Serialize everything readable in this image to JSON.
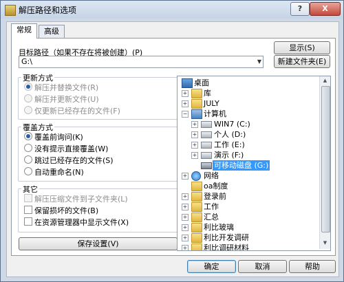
{
  "window": {
    "title": "解压路径和选项",
    "help_glyph": "?",
    "close_glyph": "X"
  },
  "tabs": [
    {
      "label": "常规",
      "active": true
    },
    {
      "label": "高级",
      "active": false
    }
  ],
  "target": {
    "label": "目标路径（如果不存在将被创建）(P)",
    "value": "G:\\",
    "show_button": "显示(S)",
    "new_folder_button": "新建文件夹(E)"
  },
  "update_mode": {
    "title": "更新方式",
    "options": [
      {
        "label": "解压并替换文件(R)",
        "checked": true,
        "enabled": false
      },
      {
        "label": "解压并更新文件(U)",
        "checked": false,
        "enabled": false
      },
      {
        "label": "仅更新已经存在的文件(F)",
        "checked": false,
        "enabled": false
      }
    ]
  },
  "overwrite_mode": {
    "title": "覆盖方式",
    "options": [
      {
        "label": "覆盖前询问(K)",
        "checked": true
      },
      {
        "label": "没有提示直接覆盖(W)",
        "checked": false
      },
      {
        "label": "跳过已经存在的文件(S)",
        "checked": false
      },
      {
        "label": "自动重命名(N)",
        "checked": false
      }
    ]
  },
  "misc": {
    "title": "其它",
    "options": [
      {
        "label": "解压压缩文件到子文件夹(L)",
        "checked": false,
        "enabled": false
      },
      {
        "label": "保留损坏的文件(B)",
        "checked": false,
        "enabled": true
      },
      {
        "label": "在资源管理器中显示文件(X)",
        "checked": false,
        "enabled": true
      }
    ]
  },
  "save_settings_button": "保存设置(V)",
  "tree": {
    "nodes": [
      {
        "label": "桌面",
        "icon": "desktop-icon",
        "expander": ""
      },
      {
        "label": "库",
        "icon": "folder-icon",
        "expander": "+"
      },
      {
        "label": "JULY",
        "icon": "folder-icon",
        "expander": "+"
      },
      {
        "label": "计算机",
        "icon": "computer-icon",
        "expander": "−"
      },
      {
        "label": "WIN7 (C:)",
        "icon": "drive-icon",
        "expander": "+"
      },
      {
        "label": "个人 (D:)",
        "icon": "drive-icon",
        "expander": "+"
      },
      {
        "label": "工作 (E:)",
        "icon": "drive-icon",
        "expander": "+"
      },
      {
        "label": "演示 (F:)",
        "icon": "drive-icon",
        "expander": "+"
      },
      {
        "label": "可移动磁盘 (G:)",
        "icon": "removable-disk-icon",
        "expander": "",
        "selected": true
      },
      {
        "label": "网络",
        "icon": "network-icon",
        "expander": "+"
      },
      {
        "label": "oa制度",
        "icon": "folder-icon",
        "expander": ""
      },
      {
        "label": "登录前",
        "icon": "folder-icon",
        "expander": "+"
      },
      {
        "label": "工作",
        "icon": "folder-icon",
        "expander": "+"
      },
      {
        "label": "汇总",
        "icon": "folder-icon",
        "expander": "+"
      },
      {
        "label": "利比玻璃",
        "icon": "folder-icon",
        "expander": "+"
      },
      {
        "label": "利比开发调研",
        "icon": "folder-icon",
        "expander": "+"
      },
      {
        "label": "利比调研材料",
        "icon": "folder-icon",
        "expander": "+"
      }
    ]
  },
  "footer": {
    "ok": "确定",
    "cancel": "取消",
    "help": "帮助"
  }
}
